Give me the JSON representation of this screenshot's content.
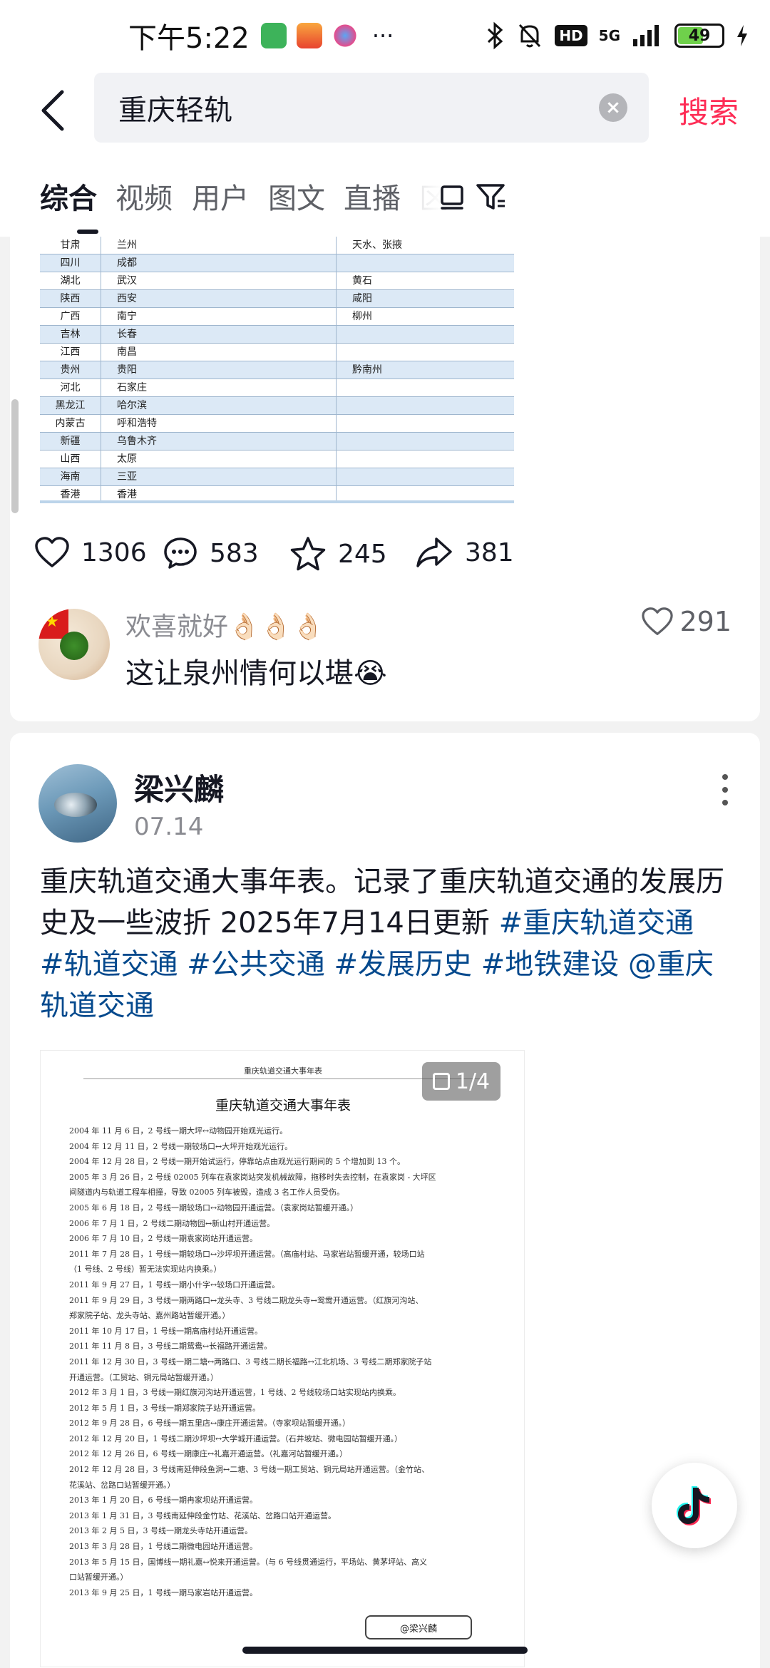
{
  "status_bar": {
    "time": "下午5:22",
    "network": "5G",
    "hd": "HD",
    "battery": "49"
  },
  "search": {
    "back_label": "返回",
    "query": "重庆轻轨",
    "clear_label": "×",
    "action": "搜索"
  },
  "tabs": [
    {
      "label": "综合"
    },
    {
      "label": "视频"
    },
    {
      "label": "用户"
    },
    {
      "label": "图文"
    },
    {
      "label": "直播"
    },
    {
      "label": "区"
    }
  ],
  "table_rows": [
    [
      "甘肃",
      "兰州",
      "天水、张掖"
    ],
    [
      "四川",
      "成都",
      ""
    ],
    [
      "湖北",
      "武汉",
      "黄石"
    ],
    [
      "陕西",
      "西安",
      "咸阳"
    ],
    [
      "广西",
      "南宁",
      "柳州"
    ],
    [
      "吉林",
      "长春",
      ""
    ],
    [
      "江西",
      "南昌",
      ""
    ],
    [
      "贵州",
      "贵阳",
      "黔南州"
    ],
    [
      "河北",
      "石家庄",
      ""
    ],
    [
      "黑龙江",
      "哈尔滨",
      ""
    ],
    [
      "内蒙古",
      "呼和浩特",
      ""
    ],
    [
      "新疆",
      "乌鲁木齐",
      ""
    ],
    [
      "山西",
      "太原",
      ""
    ],
    [
      "海南",
      "三亚",
      ""
    ],
    [
      "香港",
      "香港",
      ""
    ]
  ],
  "post1_actions": {
    "likes": "1306",
    "comments": "583",
    "favorites": "245",
    "shares": "381"
  },
  "comment": {
    "user": "欢喜就好👌🏻👌🏻👌🏻",
    "text": "这让泉州情何以堪😭",
    "likes": "291"
  },
  "post2": {
    "author": "梁兴麟",
    "date": "07.14",
    "text_plain": "重庆轨道交通大事年表。记录了重庆轨道交通的发展历史及一些波折 2025年7月14日更新 ",
    "tags": [
      "#重庆轨道交通",
      "#轨道交通",
      "#公共交通",
      "#发展历史",
      "#地铁建设",
      "@重庆轨道交通"
    ],
    "image_counter": "1/4"
  },
  "document": {
    "header": "重庆轨道交通大事年表",
    "title": "重庆轨道交通大事年表",
    "lines": [
      "2004 年 11 月 6 日，2 号线一期大坪↔动物园开始观光运行。",
      "2004 年 12 月 11 日，2 号线一期较场口↔大坪开始观光运行。",
      "2004 年 12 月 28 日，2 号线一期开始试运行，停靠站点由观光运行期间的 5 个增加到 13 个。",
      "2005 年 3 月 26 日，2 号线 02005 列车在袁家岗站突发机械故障，拖移时失去控制，在袁家岗 - 大坪区",
      "间隧道内与轨道工程车相撞，导致 02005 列车被毁，造成 3 名工作人员受伤。",
      "2005 年 6 月 18 日，2 号线一期较场口↔动物园开通运营。（袁家岗站暂缓开通。）",
      "2006 年 7 月 1 日，2 号线二期动物园↔新山村开通运营。",
      "2006 年 7 月 10 日，2 号线一期袁家岗站开通运营。",
      "2011 年 7 月 28 日，1 号线一期较场口↔沙坪坝开通运营。（高庙村站、马家岩站暂缓开通，较场口站",
      "（1 号线、2 号线）暂无法实现站内换乘。）",
      "2011 年 9 月 27 日，1 号线一期小什字↔较场口开通运营。",
      "2011 年 9 月 29 日，3 号线一期两路口↔龙头寺、3 号线二期龙头寺↔鸳鸯开通运营。（红旗河沟站、",
      "郑家院子站、龙头寺站、嘉州路站暂缓开通。）",
      "2011 年 10 月 17 日，1 号线一期高庙村站开通运营。",
      "2011 年 11 月 8 日，3 号线二期鸳鸯↔长福路开通运营。",
      "2011 年 12 月 30 日，3 号线一期二塘↔两路口、3 号线二期长福路↔江北机场、3 号线二期郑家院子站",
      "开通运营。（工贸站、铜元局站暂缓开通。）",
      "2012 年 3 月 1 日，3 号线一期红旗河沟站开通运营，1 号线、2 号线较场口站实现站内换乘。",
      "2012 年 5 月 1 日，3 号线一期郑家院子站开通运营。",
      "2012 年 9 月 28 日，6 号线一期五里店↔康庄开通运营。（寺家坝站暂缓开通。）",
      "2012 年 12 月 20 日，1 号线二期沙坪坝↔大学城开通运营。（石井坡站、微电园站暂缓开通。）",
      "2012 年 12 月 26 日，6 号线一期康庄↔礼嘉开通运营。（礼嘉河站暂缓开通。）",
      "2012 年 12 月 28 日，3 号线南延伸段鱼洞↔二塘、3 号线一期工贸站、铜元局站开通运营。（金竹站、",
      "花溪站、岔路口站暂缓开通。）",
      "2013 年 1 月 20 日，6 号线一期冉家坝站开通运营。",
      "2013 年 1 月 31 日，3 号线南延伸段金竹站、花溪站、岔路口站开通运营。",
      "2013 年 2 月 5 日，3 号线一期龙头寺站开通运营。",
      "2013 年 3 月 28 日，1 号线二期微电园站开通运营。",
      "2013 年 5 月 15 日，国博线一期礼嘉↔悦来开通运营。（与 6 号线贯通运行，平场站、黄茅坪站、高义",
      "口站暂缓开通。）",
      "2013 年 9 月 25 日，1 号线一期马家岩站开通运营。"
    ],
    "watermark": "@梁兴麟"
  },
  "colors": {
    "accent": "#fe2c55",
    "tag": "#04498d",
    "table_header_blue": "#dce9f6"
  },
  "icons": [
    "back-arrow-icon",
    "clear-icon",
    "layout-icon",
    "filter-icon",
    "heart-icon",
    "comment-icon",
    "star-icon",
    "share-icon",
    "more-icon",
    "douyin-logo-icon"
  ]
}
